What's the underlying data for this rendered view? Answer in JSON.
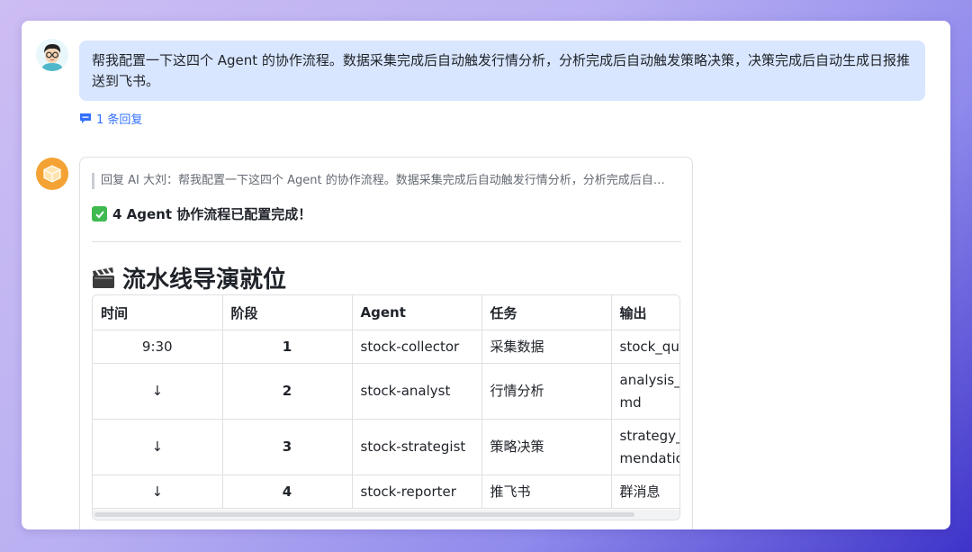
{
  "user_message": {
    "text": "帮我配置一下这四个 Agent 的协作流程。数据采集完成后自动触发行情分析，分析完成后自动触发策略决策，决策完成后自动生成日报推送到飞书。",
    "reply_count_label": "1 条回复"
  },
  "bot_reply": {
    "quote": "回复 AI 大刘：帮我配置一下这四个 Agent 的协作流程。数据采集完成后自动触发行情分析，分析完成后自…",
    "status_line": "4 Agent 协作流程已配置完成！",
    "heading": "流水线导演就位",
    "table": {
      "headers": [
        "时间",
        "阶段",
        "Agent",
        "任务",
        "输出"
      ],
      "rows": [
        {
          "time": "9:30",
          "stage": "1",
          "agent": "stock-collector",
          "task": "采集数据",
          "output": "stock_qu"
        },
        {
          "time": "↓",
          "stage": "2",
          "agent": "stock-analyst",
          "task": "行情分析",
          "output": "analysis_\nmd"
        },
        {
          "time": "↓",
          "stage": "3",
          "agent": "stock-strategist",
          "task": "策略决策",
          "output": "strategy_\nmendatio"
        },
        {
          "time": "↓",
          "stage": "4",
          "agent": "stock-reporter",
          "task": "推飞书",
          "output": "群消息"
        }
      ]
    }
  },
  "icons": {
    "user_avatar": "user-avatar-icon",
    "bot_avatar": "cube-box-icon",
    "reply": "comment-icon",
    "check": "checkmark-icon",
    "clapper": "clapperboard-icon"
  },
  "colors": {
    "accent": "#3370ff",
    "bubble": "#d9e6ff",
    "bot_avatar": "#f4a233",
    "check": "#3fb950"
  }
}
